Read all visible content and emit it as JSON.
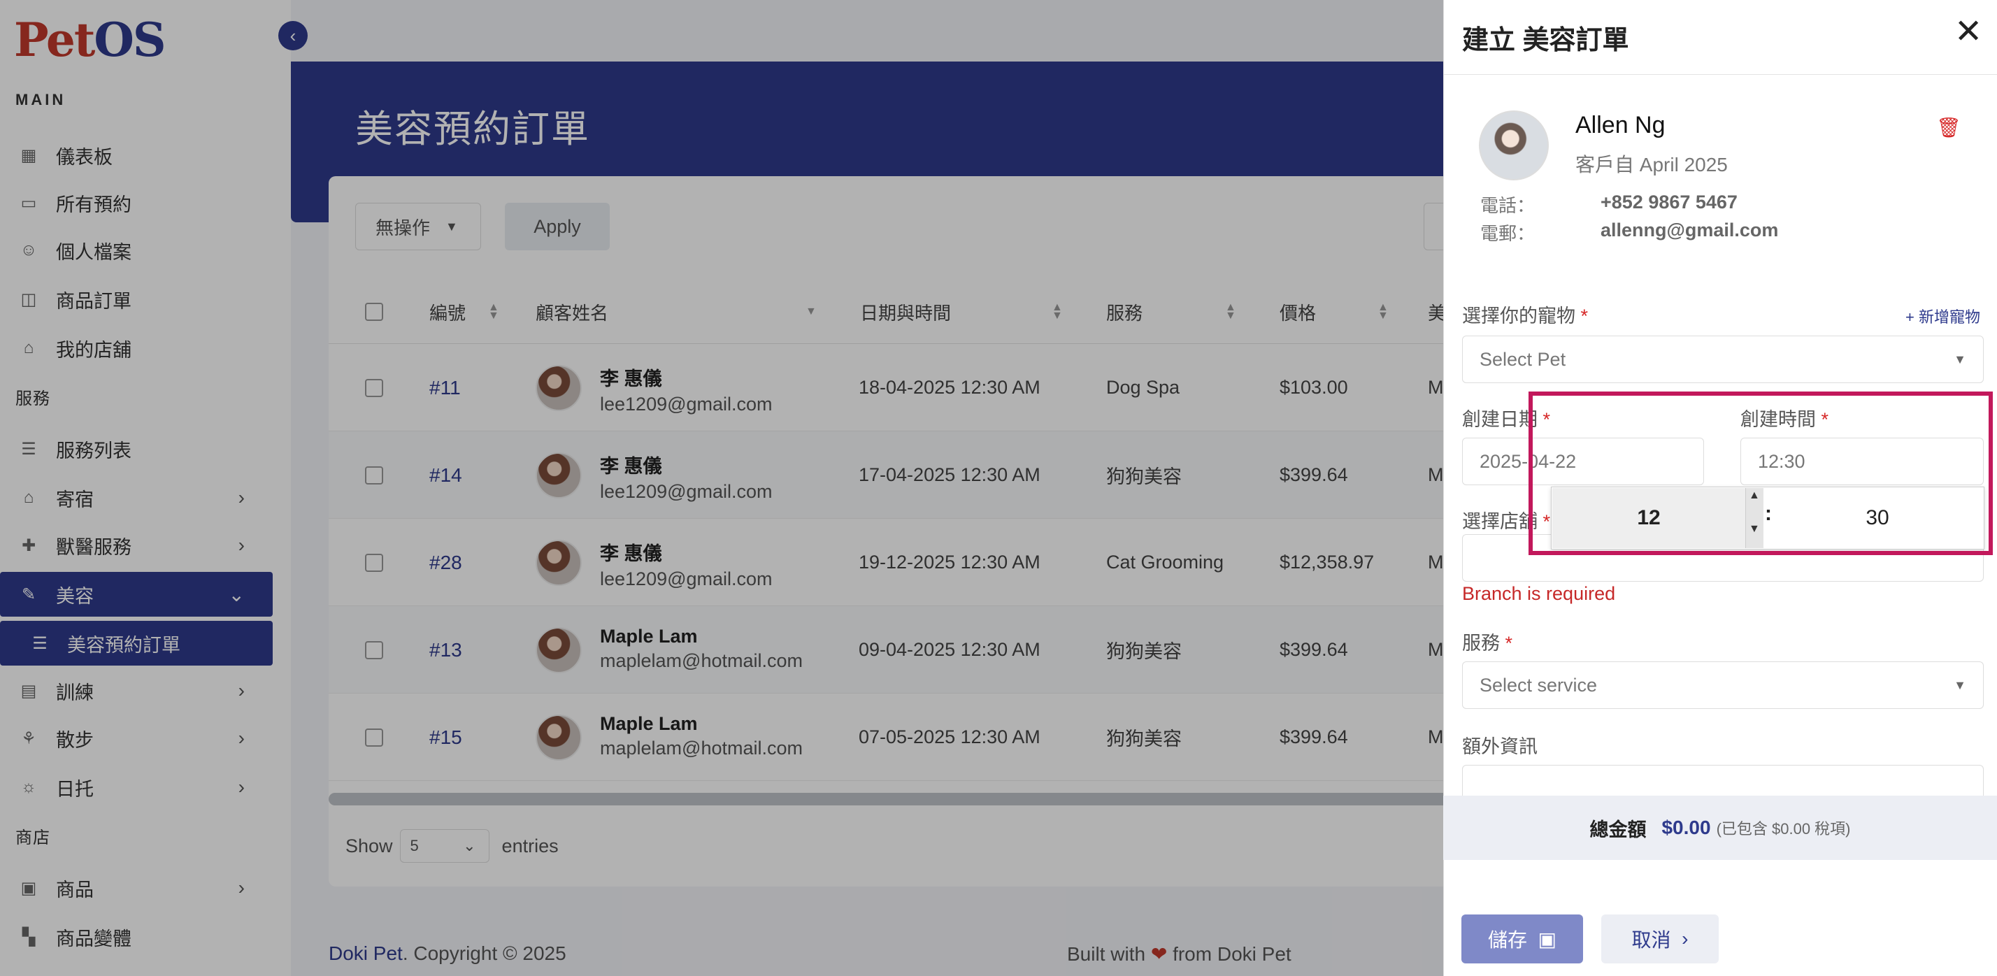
{
  "app": {
    "logo_pet": "Pet",
    "logo_os": "OS"
  },
  "sidebar": {
    "section_main": "MAIN",
    "section_services": "服務",
    "section_shop": "商店",
    "items": [
      {
        "label": "儀表板",
        "icon": "grid-icon"
      },
      {
        "label": "所有預約",
        "icon": "calendar-icon"
      },
      {
        "label": "個人檔案",
        "icon": "user-icon"
      },
      {
        "label": "商品訂單",
        "icon": "bag-icon"
      },
      {
        "label": "我的店舖",
        "icon": "store-icon"
      },
      {
        "label": "服務列表",
        "icon": "list-icon"
      },
      {
        "label": "寄宿",
        "icon": "home-icon"
      },
      {
        "label": "獸醫服務",
        "icon": "medical-icon"
      },
      {
        "label": "美容",
        "icon": "brush-icon"
      },
      {
        "label": "美容預約訂單",
        "icon": "list-icon"
      },
      {
        "label": "訓練",
        "icon": "training-icon"
      },
      {
        "label": "散步",
        "icon": "walk-icon"
      },
      {
        "label": "日托",
        "icon": "daycare-icon"
      },
      {
        "label": "商品",
        "icon": "box-icon"
      },
      {
        "label": "商品變體",
        "icon": "variant-icon"
      }
    ],
    "chevron_right": "›",
    "chevron_down": "⌄"
  },
  "main": {
    "title": "美容預約訂單",
    "bulk_action": "無操作",
    "apply": "Apply",
    "columns": [
      "編號",
      "顧客姓名",
      "日期與時間",
      "服務",
      "價格",
      "美"
    ],
    "rows": [
      {
        "id": "#11",
        "name": "李 惠儀",
        "email": "lee1209@gmail.com",
        "datetime": "18-04-2025 12:30 AM",
        "service": "Dog Spa",
        "price": "$103.00",
        "extra": "M"
      },
      {
        "id": "#14",
        "name": "李 惠儀",
        "email": "lee1209@gmail.com",
        "datetime": "17-04-2025 12:30 AM",
        "service": "狗狗美容",
        "price": "$399.64",
        "extra": "M"
      },
      {
        "id": "#28",
        "name": "李 惠儀",
        "email": "lee1209@gmail.com",
        "datetime": "19-12-2025 12:30 AM",
        "service": "Cat Grooming",
        "price": "$12,358.97",
        "extra": "M"
      },
      {
        "id": "#13",
        "name": "Maple Lam",
        "email": "maplelam@hotmail.com",
        "datetime": "09-04-2025 12:30 AM",
        "service": "狗狗美容",
        "price": "$399.64",
        "extra": "M"
      },
      {
        "id": "#15",
        "name": "Maple Lam",
        "email": "maplelam@hotmail.com",
        "datetime": "07-05-2025 12:30 AM",
        "service": "狗狗美容",
        "price": "$399.64",
        "extra": "M"
      }
    ],
    "show_label": "Show",
    "show_value": "5",
    "entries_label": "entries"
  },
  "footer": {
    "brand": "Doki Pet",
    "copyright": ". Copyright © 2025",
    "built_with": "Built with",
    "heart": "❤",
    "from": "from Doki Pet"
  },
  "drawer": {
    "title": "建立 美容訂單",
    "customer": {
      "name": "Allen Ng",
      "since": "客戶自 April 2025",
      "phone_label": "電話：",
      "phone": "+852 9867 5467",
      "email_label": "電郵：",
      "email": "allenng@gmail.com"
    },
    "pet_label": "選擇你的寵物",
    "add_pet": "+ 新增寵物",
    "pet_placeholder": "Select Pet",
    "date_label": "創建日期",
    "date_value": "2025-04-22",
    "time_label": "創建時間",
    "time_value": "12:30",
    "time_picker": {
      "hour": "12",
      "minute": "30",
      "separator": ":"
    },
    "branch_label": "選擇店舖",
    "branch_error": "Branch is required",
    "service_label": "服務",
    "service_placeholder": "Select service",
    "extra_label": "額外資訊",
    "required_mark": "*",
    "total_label": "總金額",
    "total_value": "$0.00",
    "total_tax": "(已包含 $0.00 稅項)",
    "save": "儲存",
    "cancel": "取消"
  }
}
